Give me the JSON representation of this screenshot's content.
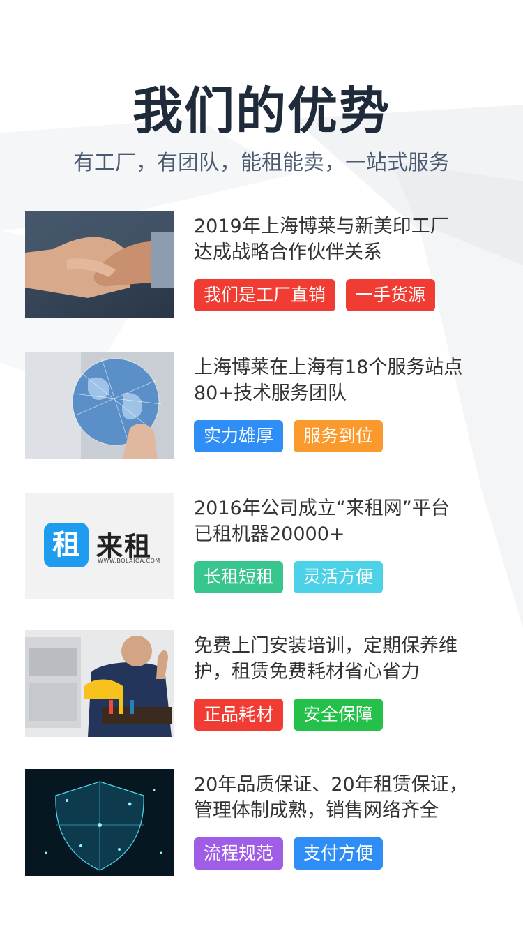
{
  "header": {
    "title": "我们的优势",
    "subtitle": "有工厂，有团队，能租能卖，一站式服务"
  },
  "items": [
    {
      "desc_line1": "2019年上海博莱与新美印工厂",
      "desc_line2": "达成战略合作伙伴关系",
      "image_icon": "handshake-photo",
      "tags": [
        {
          "label": "我们是工厂直销",
          "color": "#f03c32"
        },
        {
          "label": "一手货源",
          "color": "#f03c32"
        }
      ]
    },
    {
      "desc_line1": "上海博莱在上海有18个服务站点",
      "desc_line2": "80+技术服务团队",
      "image_icon": "globe-network-photo",
      "tags": [
        {
          "label": "实力雄厚",
          "color": "#2f8ef5"
        },
        {
          "label": "服务到位",
          "color": "#fb9a2c"
        }
      ]
    },
    {
      "desc_line1": "2016年公司成立“来租网”平台",
      "desc_line2": "已租机器20000+",
      "image_icon": "lailai-logo",
      "logo_glyph": "租",
      "logo_name": "来租",
      "logo_url": "WWW.BOLAIOA.COM",
      "tags": [
        {
          "label": "长租短租",
          "color": "#39c58e"
        },
        {
          "label": "灵活方便",
          "color": "#4cd2e6"
        }
      ]
    },
    {
      "desc_line1": "免费上门安装培训，定期保养维",
      "desc_line2": "护，租赁免费耗材省心省力",
      "image_icon": "technician-photo",
      "tags": [
        {
          "label": "正品耗材",
          "color": "#f03c32"
        },
        {
          "label": "安全保障",
          "color": "#23c04a"
        }
      ]
    },
    {
      "desc_line1": "20年品质保证、20年租赁保证，",
      "desc_line2": "管理体制成熟，销售网络齐全",
      "image_icon": "shield-network-photo",
      "tags": [
        {
          "label": "流程规范",
          "color": "#a05ee6"
        },
        {
          "label": "支付方便",
          "color": "#2f8ef5"
        }
      ]
    }
  ]
}
